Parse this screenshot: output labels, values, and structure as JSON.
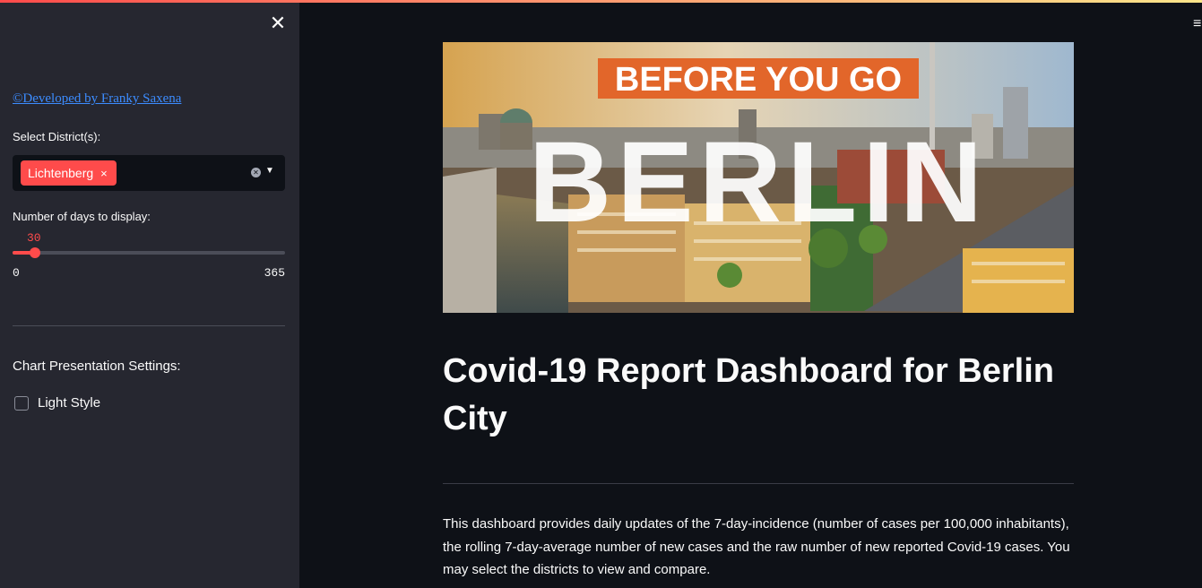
{
  "sidebar": {
    "close_symbol": "✕",
    "developer_link": "©Developed by Franky Saxena",
    "district_label": "Select District(s):",
    "selected_districts": [
      "Lichtenberg"
    ],
    "tag_remove_symbol": "×",
    "days_label": "Number of days to display:",
    "days_value": "30",
    "days_min": "0",
    "days_max": "365",
    "chart_settings_label": "Chart Presentation Settings:",
    "light_style_label": "Light Style",
    "light_style_checked": false
  },
  "header": {
    "menu_symbol": "≡"
  },
  "banner": {
    "top_text": "BEFORE YOU GO",
    "city_text": "BERLIN"
  },
  "main": {
    "title": "Covid-19 Report Dashboard for Berlin City",
    "description": "This dashboard provides daily updates of the 7-day-incidence (number of cases per 100,000 inhabitants), the rolling 7-day-average number of new cases and the raw number of new reported Covid-19 cases. You may select the districts to view and compare."
  },
  "colors": {
    "accent": "#ff4b4b",
    "sidebar_bg": "#262730",
    "main_bg": "#0e1117",
    "link": "#3c8cff",
    "banner_label": "#e2662a"
  },
  "slider_fraction": 0.0822
}
